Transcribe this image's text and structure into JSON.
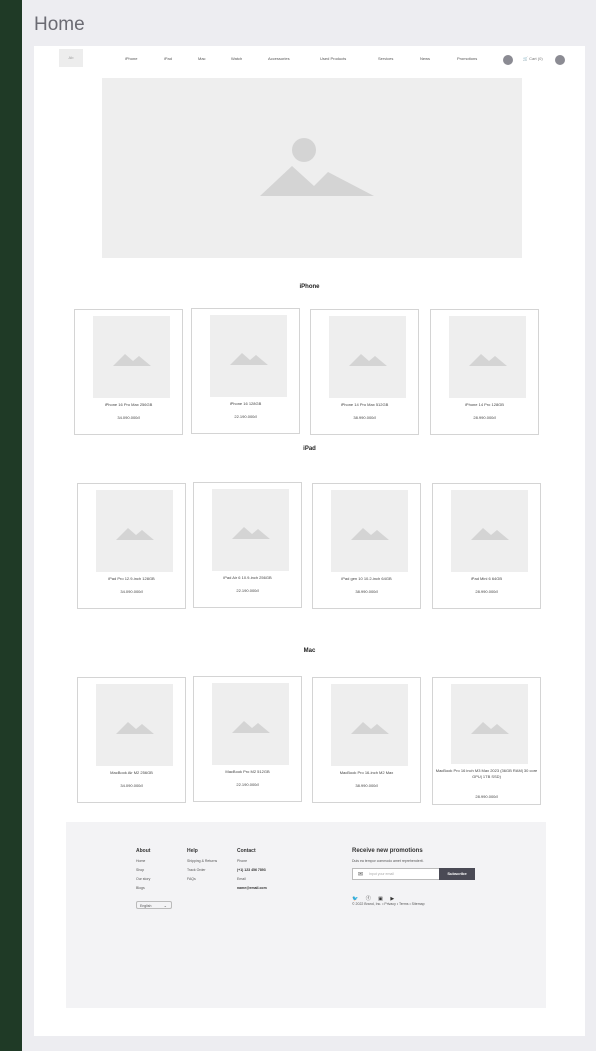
{
  "page_title": "Home",
  "nav": {
    "logo": "Ab",
    "items": [
      "iPhone",
      "iPad",
      "Mac",
      "Watch",
      "Accessories",
      "Used Products",
      "Services",
      "News",
      "Promotions"
    ],
    "cart_label": "Cart (0)"
  },
  "sections": [
    {
      "title": "iPhone",
      "products": [
        {
          "name": "iPhone 16 Pro Max 256GB",
          "price": "34.090.000đ"
        },
        {
          "name": "iPhone 16 128GB",
          "price": "22.190.000đ"
        },
        {
          "name": "iPhone 14 Pro Max 512GB",
          "price": "38.990.000đ"
        },
        {
          "name": "iPhone 14 Pro 128GB",
          "price": "28.990.000đ"
        }
      ]
    },
    {
      "title": "iPad",
      "products": [
        {
          "name": "iPad Pro 12.9-inch 128GB",
          "price": "34.090.000đ"
        },
        {
          "name": "iPad Air 6 10.9-inch 256GB",
          "price": "22.190.000đ"
        },
        {
          "name": "iPad gen 10 10.2-inch 64GB",
          "price": "38.990.000đ"
        },
        {
          "name": "iPad Mini 6 64GB",
          "price": "28.990.000đ"
        }
      ]
    },
    {
      "title": "Mac",
      "products": [
        {
          "name": "MacBook Air M2 256GB",
          "price": "34.090.000đ"
        },
        {
          "name": "MacBook Pro M2 512GB",
          "price": "22.190.000đ"
        },
        {
          "name": "MacBook Pro 16-inch M2 Max",
          "price": "38.990.000đ"
        },
        {
          "name": "MacBook Pro 16 inch M3 Max 2023 (36GB RAM| 30 core GPU| 1TB SSD)",
          "price": "28.990.000đ"
        }
      ]
    }
  ],
  "footer": {
    "about": {
      "title": "About",
      "links": [
        "Home",
        "Shop",
        "Our story",
        "Blogs"
      ]
    },
    "help": {
      "title": "Help",
      "links": [
        "Shipping & Returns",
        "Track Order",
        "FAQs"
      ]
    },
    "contact": {
      "title": "Contact",
      "phone_label": "Phone",
      "phone": "(+1) 123 456 7893",
      "email_label": "Email",
      "email": "name@email.com"
    },
    "language": "English",
    "promo_title": "Receive new promotions",
    "promo_sub": "Duis ea tempor commodo amet reprehenderit.",
    "email_placeholder": "Input your email",
    "subscribe_label": "Subscribe",
    "legal": "© 2022 Brand, Inc. • Privacy • Terms • Sitemap"
  }
}
